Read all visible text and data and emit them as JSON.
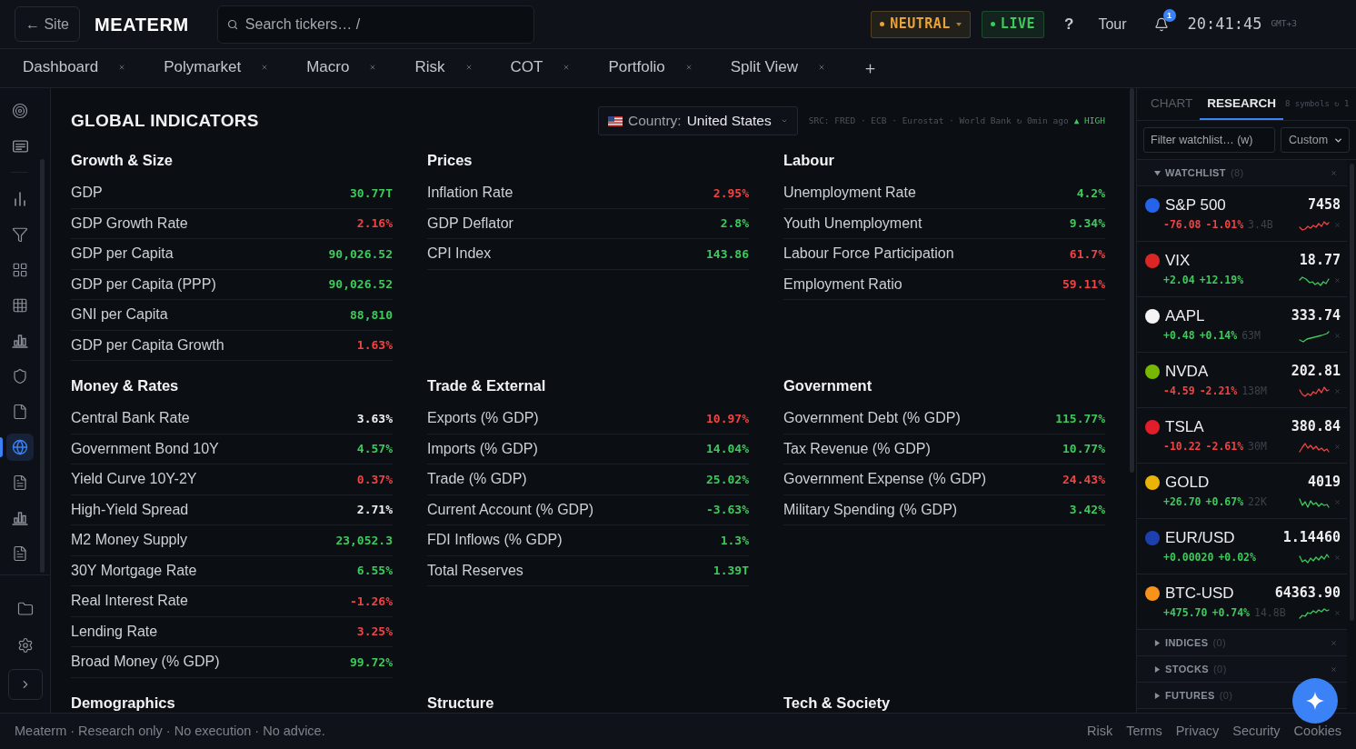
{
  "top_bar": {
    "back_button": "← Site",
    "logo": "MEATERM",
    "search": {
      "placeholder": "Search tickers… /"
    },
    "status_badges": [
      {
        "label": "NEUTRAL",
        "color": "#e8a23a",
        "kind": "dropdown"
      },
      {
        "label": "LIVE",
        "color": "#3ec95c",
        "kind": "plain"
      }
    ],
    "help": "?",
    "tour": "Tour",
    "notifications": {
      "count": "1"
    },
    "clock": {
      "time": "20:41:45",
      "zone": "GMT+3"
    }
  },
  "tabs": [
    {
      "label": "Dashboard",
      "selected": false
    },
    {
      "label": "Polymarket",
      "selected": false
    },
    {
      "label": "Macro",
      "selected": false
    },
    {
      "label": "Risk",
      "selected": false
    },
    {
      "label": "COT",
      "selected": false
    },
    {
      "label": "Portfolio",
      "selected": false
    },
    {
      "label": "Split View",
      "selected": false
    }
  ],
  "sidebar": {
    "items": [
      {
        "selected": false
      },
      {
        "selected": false
      },
      {
        "selected": false
      },
      {
        "selected": false
      },
      {
        "selected": false
      },
      {
        "selected": false
      },
      {
        "selected": false
      },
      {
        "selected": false
      },
      {
        "selected": false
      },
      {
        "selected": true
      },
      {
        "selected": false
      },
      {
        "selected": false
      },
      {
        "selected": false
      }
    ],
    "bottom_items": [
      {
        "selected": false
      },
      {
        "selected": false
      }
    ]
  },
  "page": {
    "title": "GLOBAL INDICATORS",
    "country": {
      "label": "Country:",
      "value": "United States"
    },
    "sources": {
      "text": "SRC: FRED · ECB · Eurostat · World Bank ↻ 0min ago",
      "quality": "▲ HIGH"
    },
    "sections": [
      {
        "title": "Growth & Size",
        "rows": [
          {
            "label": "GDP",
            "value": "30.77T",
            "color": "#3ec95c"
          },
          {
            "label": "GDP Growth Rate",
            "value": "2.16%",
            "color": "#ef4444"
          },
          {
            "label": "GDP per Capita",
            "value": "90,026.52",
            "color": "#3ec95c"
          },
          {
            "label": "GDP per Capita (PPP)",
            "value": "90,026.52",
            "color": "#3ec95c"
          },
          {
            "label": "GNI per Capita",
            "value": "88,810",
            "color": "#3ec95c"
          },
          {
            "label": "GDP per Capita Growth",
            "value": "1.63%",
            "color": "#ef4444"
          }
        ]
      },
      {
        "title": "Prices",
        "rows": [
          {
            "label": "Inflation Rate",
            "value": "2.95%",
            "color": "#ef4444"
          },
          {
            "label": "GDP Deflator",
            "value": "2.8%",
            "color": "#3ec95c"
          },
          {
            "label": "CPI Index",
            "value": "143.86",
            "color": "#3ec95c"
          }
        ]
      },
      {
        "title": "Labour",
        "rows": [
          {
            "label": "Unemployment Rate",
            "value": "4.2%",
            "color": "#3ec95c"
          },
          {
            "label": "Youth Unemployment",
            "value": "9.34%",
            "color": "#3ec95c"
          },
          {
            "label": "Labour Force Participation",
            "value": "61.7%",
            "color": "#ef4444"
          },
          {
            "label": "Employment Ratio",
            "value": "59.11%",
            "color": "#ef4444"
          }
        ]
      },
      {
        "title": "Money & Rates",
        "rows": [
          {
            "label": "Central Bank Rate",
            "value": "3.63%",
            "color": "#f0f1f3"
          },
          {
            "label": "Government Bond 10Y",
            "value": "4.57%",
            "color": "#3ec95c"
          },
          {
            "label": "Yield Curve 10Y-2Y",
            "value": "0.37%",
            "color": "#ef4444"
          },
          {
            "label": "High-Yield Spread",
            "value": "2.71%",
            "color": "#f0f1f3"
          },
          {
            "label": "M2 Money Supply",
            "value": "23,052.3",
            "color": "#3ec95c"
          },
          {
            "label": "30Y Mortgage Rate",
            "value": "6.55%",
            "color": "#3ec95c"
          },
          {
            "label": "Real Interest Rate",
            "value": "-1.26%",
            "color": "#ef4444"
          },
          {
            "label": "Lending Rate",
            "value": "3.25%",
            "color": "#ef4444"
          },
          {
            "label": "Broad Money (% GDP)",
            "value": "99.72%",
            "color": "#3ec95c"
          }
        ]
      },
      {
        "title": "Trade & External",
        "rows": [
          {
            "label": "Exports (% GDP)",
            "value": "10.97%",
            "color": "#ef4444"
          },
          {
            "label": "Imports (% GDP)",
            "value": "14.04%",
            "color": "#3ec95c"
          },
          {
            "label": "Trade (% GDP)",
            "value": "25.02%",
            "color": "#3ec95c"
          },
          {
            "label": "Current Account (% GDP)",
            "value": "-3.63%",
            "color": "#3ec95c"
          },
          {
            "label": "FDI Inflows (% GDP)",
            "value": "1.3%",
            "color": "#3ec95c"
          },
          {
            "label": "Total Reserves",
            "value": "1.39T",
            "color": "#3ec95c"
          }
        ]
      },
      {
        "title": "Government",
        "rows": [
          {
            "label": "Government Debt (% GDP)",
            "value": "115.77%",
            "color": "#3ec95c"
          },
          {
            "label": "Tax Revenue (% GDP)",
            "value": "10.77%",
            "color": "#3ec95c"
          },
          {
            "label": "Government Expense (% GDP)",
            "value": "24.43%",
            "color": "#ef4444"
          },
          {
            "label": "Military Spending (% GDP)",
            "value": "3.42%",
            "color": "#3ec95c"
          }
        ]
      },
      {
        "title": "Demographics"
      },
      {
        "title": "Structure"
      },
      {
        "title": "Tech & Society"
      }
    ]
  },
  "right_panel": {
    "tabs": [
      {
        "label": "CHART",
        "selected": false
      },
      {
        "label": "RESEARCH",
        "selected": true
      }
    ],
    "summary": "8 symbols ↻ 1",
    "filter": {
      "placeholder": "Filter watchlist… (w)"
    },
    "list_select": {
      "value": "Custom"
    },
    "groups": [
      {
        "title": "WATCHLIST",
        "count": "(8)",
        "expanded": true,
        "items": [
          {
            "symbol": "S&P 500",
            "price": "7458",
            "change": "-76.08",
            "change_pct": "-1.01%",
            "volume": "3.4B",
            "kind": "down",
            "color": "#2563eb"
          },
          {
            "symbol": "VIX",
            "price": "18.77",
            "change": "+2.04",
            "change_pct": "+12.19%",
            "kind": "up",
            "color": "#dc2626"
          },
          {
            "symbol": "AAPL",
            "price": "333.74",
            "change": "+0.48",
            "change_pct": "+0.14%",
            "volume": "63M",
            "kind": "up",
            "color": "#f4f4f5"
          },
          {
            "symbol": "NVDA",
            "price": "202.81",
            "change": "-4.59",
            "change_pct": "-2.21%",
            "volume": "138M",
            "kind": "down",
            "color": "#76b900"
          },
          {
            "symbol": "TSLA",
            "price": "380.84",
            "change": "-10.22",
            "change_pct": "-2.61%",
            "volume": "30M",
            "kind": "down",
            "color": "#e11d2a"
          },
          {
            "symbol": "GOLD",
            "price": "4019",
            "change": "+26.70",
            "change_pct": "+0.67%",
            "volume": "22K",
            "kind": "up",
            "color": "#eab308"
          },
          {
            "symbol": "EUR/USD",
            "price": "1.14460",
            "change": "+0.00020",
            "change_pct": "+0.02%",
            "kind": "up",
            "color": "#1e40af"
          },
          {
            "symbol": "BTC-USD",
            "price": "64363.90",
            "change": "+475.70",
            "change_pct": "+0.74%",
            "volume": "14.8B",
            "kind": "up",
            "color": "#f7931a"
          }
        ]
      },
      {
        "title": "INDICES",
        "count": "(0)",
        "expanded": false
      },
      {
        "title": "STOCKS",
        "count": "(0)",
        "expanded": false
      },
      {
        "title": "FUTURES",
        "count": "(0)",
        "expanded": false
      }
    ]
  },
  "footer": {
    "note": "Meaterm · Research only · No execution · No advice.",
    "links": [
      "Risk",
      "Terms",
      "Privacy",
      "Security",
      "Cookies"
    ]
  }
}
